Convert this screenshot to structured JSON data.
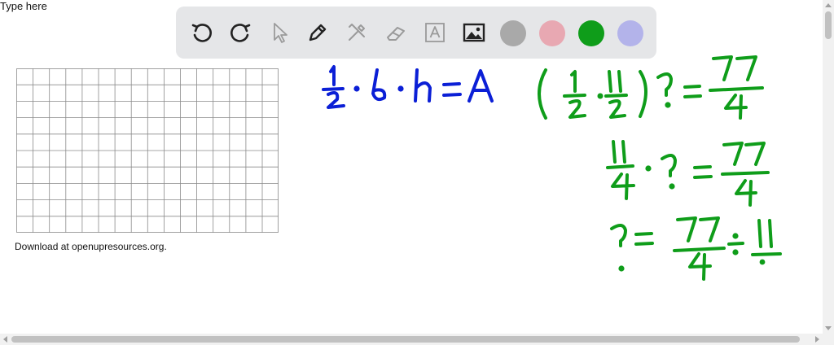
{
  "page": {
    "type_here": "Type here",
    "caption": "Download at openupresources.org."
  },
  "toolbar": {
    "tools": [
      "undo-icon",
      "redo-icon",
      "select-pointer-icon",
      "pen-icon",
      "tools-icon",
      "eraser-icon",
      "text-box-icon",
      "image-icon"
    ],
    "colors": {
      "gray": "#a9a9a9",
      "pink": "#e8a8b2",
      "green": "#0f9d1a",
      "lavender": "#b3b3ea"
    }
  },
  "ink": {
    "blue": "#0b1fd6",
    "green": "#0f9d1a"
  }
}
